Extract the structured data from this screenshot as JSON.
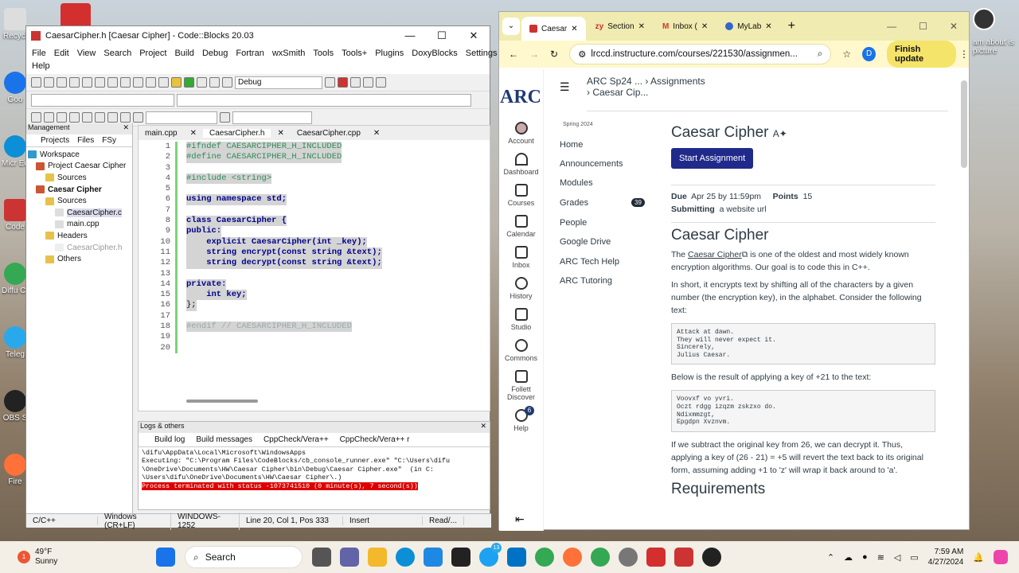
{
  "desktop": {
    "icons": [
      "Recycl",
      "Goo",
      "Micr Ed",
      "Code",
      "Diffu Chro",
      "Teleg",
      "OBS S",
      "Fire"
    ],
    "right_text": "am about is picture"
  },
  "codeblocks": {
    "title": "CaesarCipher.h [Caesar Cipher] - Code::Blocks 20.03",
    "menu": [
      "File",
      "Edit",
      "View",
      "Search",
      "Project",
      "Build",
      "Debug",
      "Fortran",
      "wxSmith",
      "Tools",
      "Tools+",
      "Plugins",
      "DoxyBlocks",
      "Settings",
      "Help"
    ],
    "build_target": "Debug",
    "management": {
      "header": "Management",
      "tabs": [
        "Projects",
        "Files",
        "FSy"
      ],
      "tree": [
        "Workspace",
        "Project Caesar Cipher",
        "Sources",
        "Caesar Cipher",
        "Sources",
        "CaesarCipher.c",
        "main.cpp",
        "Headers",
        "CaesarCipher.h",
        "Others"
      ]
    },
    "editor_tabs": [
      "main.cpp",
      "CaesarCipher.h",
      "CaesarCipher.cpp"
    ],
    "code": [
      {
        "n": "1",
        "t": "#ifndef CAESARCIPHER_H_INCLUDED",
        "c": "pp"
      },
      {
        "n": "2",
        "t": "#define CAESARCIPHER_H_INCLUDED",
        "c": "pp"
      },
      {
        "n": "3",
        "t": "",
        "c": ""
      },
      {
        "n": "4",
        "t": "#include <string>",
        "c": "pp"
      },
      {
        "n": "5",
        "t": "",
        "c": ""
      },
      {
        "n": "6",
        "t": "using namespace std;",
        "c": "kw"
      },
      {
        "n": "7",
        "t": "",
        "c": ""
      },
      {
        "n": "8",
        "t": "class CaesarCipher {",
        "c": "kw"
      },
      {
        "n": "9",
        "t": "public:",
        "c": "kw"
      },
      {
        "n": "10",
        "t": "    explicit CaesarCipher(int _key);",
        "c": "kw"
      },
      {
        "n": "11",
        "t": "    string encrypt(const string &text);",
        "c": "ty"
      },
      {
        "n": "12",
        "t": "    string decrypt(const string &text);",
        "c": "ty"
      },
      {
        "n": "13",
        "t": "",
        "c": ""
      },
      {
        "n": "14",
        "t": "private:",
        "c": "kw"
      },
      {
        "n": "15",
        "t": "    int key;",
        "c": "ty"
      },
      {
        "n": "16",
        "t": "};",
        "c": ""
      },
      {
        "n": "17",
        "t": "",
        "c": ""
      },
      {
        "n": "18",
        "t": "#endif // CAESARCIPHER_H_INCLUDED",
        "c": "cm"
      },
      {
        "n": "19",
        "t": "",
        "c": ""
      },
      {
        "n": "20",
        "t": "",
        "c": ""
      }
    ],
    "logs": {
      "header": "Logs & others",
      "tabs": [
        "Build log",
        "Build messages",
        "CppCheck/Vera++",
        "CppCheck/Vera++ r"
      ],
      "lines": [
        "\\difu\\AppData\\Local\\Microsoft\\WindowsApps",
        "Executing: \"C:\\Program Files\\CodeBlocks/cb_console_runner.exe\" \"C:\\Users\\difu",
        "\\OneDrive\\Documents\\HW\\Caesar Cipher\\bin\\Debug\\Caesar Cipher.exe\"  (in C:",
        "\\Users\\difu\\OneDrive\\Documents\\HW\\Caesar Cipher\\.)"
      ],
      "error": "Process terminated with status -1073741510 (0 minute(s), 7 second(s))"
    },
    "status": [
      "C/C++",
      "Windows (CR+LF)",
      "WINDOWS-1252",
      "Line 20, Col 1, Pos 333",
      "Insert",
      "Read/..."
    ]
  },
  "browser": {
    "tabs": [
      "Caesar",
      "Section",
      "Inbox (",
      "MyLab"
    ],
    "url": "lrccd.instructure.com/courses/221530/assignmen...",
    "finish_update": "Finish update",
    "profile": "D",
    "canvas_nav": [
      "Account",
      "Dashboard",
      "Courses",
      "Calendar",
      "Inbox",
      "History",
      "Studio",
      "Commons",
      "Follett Discover",
      "Help"
    ],
    "help_badge": "6",
    "breadcrumb": {
      "course": "ARC Sp24 ...",
      "section": "Assignments",
      "page": "Caesar Cip..."
    },
    "term": "Spring 2024",
    "course_nav": [
      "Home",
      "Announcements",
      "Modules",
      "Grades",
      "People",
      "Google Drive",
      "ARC Tech Help",
      "ARC Tutoring"
    ],
    "grades_badge": "39",
    "assignment": {
      "title": "Caesar Cipher",
      "start": "Start Assignment",
      "due_label": "Due",
      "due": "Apr 25 by 11:59pm",
      "points_label": "Points",
      "points": "15",
      "sub_label": "Submitting",
      "sub": "a website url",
      "h2": "Caesar Cipher",
      "p1a": "The ",
      "p1link": "Caesar Cipher",
      "p1b": " is one of the oldest and most widely known encryption algorithms.  Our goal is to code this in C++.",
      "p2": "In short, it encrypts text by shifting all of the characters by a given number (the encryption key), in the alphabet. Consider the following text:",
      "pre1": "Attack at dawn.\nThey will never expect it.\nSincerely,\nJulius Caesar.",
      "p3": "Below is the result of applying a key of +21 to the text:",
      "pre2": "Voovxf vo yvri.\nOczt rdgg izqzm zskzxo do.\nNdixmmzgt,\nEpgdpn Xvznvm.",
      "p4": "If we subtract the original key from 26, we can decrypt it.  Thus, applying a key of (26 - 21) = +5 will revert the text back to its original form, assuming adding +1 to 'z' will wrap it back around to 'a'.",
      "h3": "Requirements"
    }
  },
  "taskbar": {
    "weather_temp": "49°F",
    "weather_desc": "Sunny",
    "weather_badge": "1",
    "search": "Search",
    "time": "7:59 AM",
    "date": "4/27/2024",
    "badge13": "13"
  }
}
